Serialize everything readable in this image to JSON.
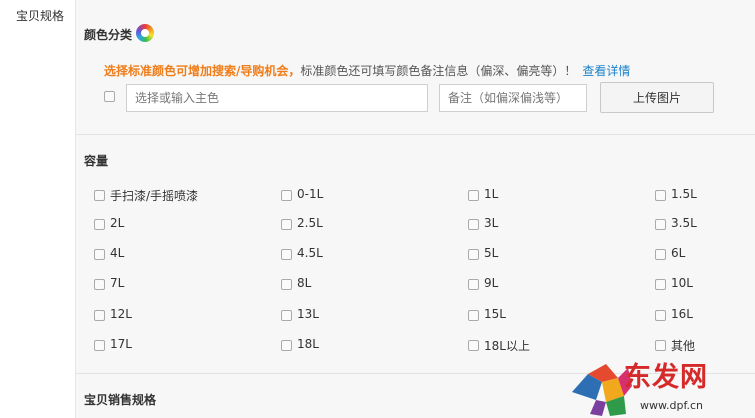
{
  "left_label": "宝贝规格",
  "color_section": {
    "title": "颜色分类",
    "tip_highlight": "选择标准颜色可增加搜索/导购机会，",
    "tip_text": "标准颜色还可填写颜色备注信息（偏深、偏亮等）！",
    "tip_link": "查看详情",
    "main_color_placeholder": "选择或输入主色",
    "note_placeholder": "备注（如偏深偏浅等）",
    "upload_label": "上传图片"
  },
  "capacity_section": {
    "title": "容量",
    "options": [
      [
        "手扫漆/手摇喷漆",
        "0-1L",
        "1L",
        "1.5L"
      ],
      [
        "2L",
        "2.5L",
        "3L",
        "3.5L"
      ],
      [
        "4L",
        "4.5L",
        "5L",
        "6L"
      ],
      [
        "7L",
        "8L",
        "9L",
        "10L"
      ],
      [
        "12L",
        "13L",
        "15L",
        "16L"
      ],
      [
        "17L",
        "18L",
        "18L以上",
        "其他"
      ]
    ]
  },
  "sales_section": {
    "title": "宝贝销售规格"
  },
  "watermark": {
    "brand": "东发网",
    "url": "www.dpf.cn",
    "logo": "geometric-lion-logo-icon"
  }
}
